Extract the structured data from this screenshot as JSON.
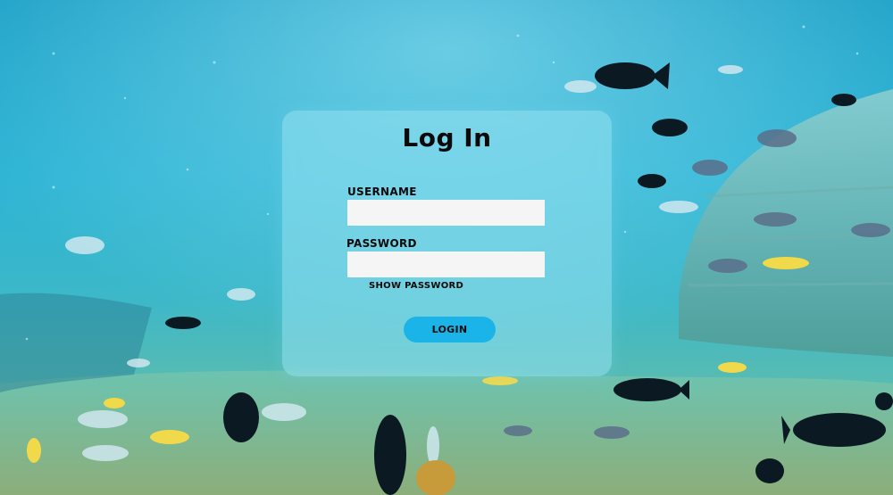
{
  "login": {
    "title": "Log In",
    "username_label": "USERNAME",
    "username_value": "",
    "password_label": "PASSWORD",
    "password_value": "",
    "show_password_label": "SHOW PASSWORD",
    "login_button_label": "LOGIN"
  },
  "colors": {
    "water_top": "#1a9fc6",
    "water_bottom": "#6fae8a",
    "card_bg": "rgba(150,225,240,0.55)",
    "button_bg": "#1ab4e8",
    "input_bg": "#f5f5f5"
  }
}
